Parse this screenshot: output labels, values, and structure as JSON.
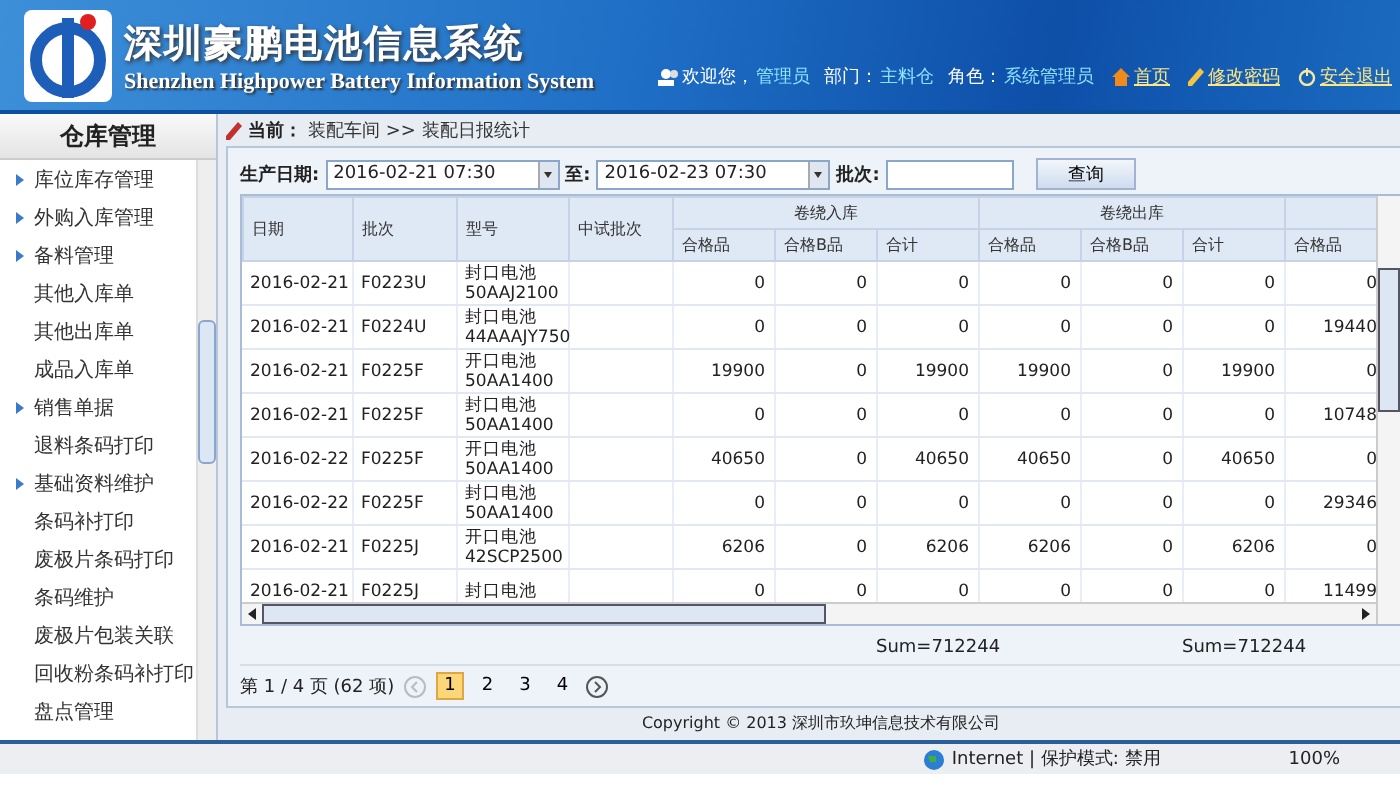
{
  "header": {
    "title": "深圳豪鹏电池信息系统",
    "subtitle": "Shenzhen Highpower Battery Information System",
    "welcome_label": "欢迎您，",
    "user": "管理员",
    "dept_label": "部门：",
    "dept": "主料仓",
    "role_label": "角色：",
    "role": "系统管理员",
    "links": [
      {
        "label": "首页",
        "kind": "home"
      },
      {
        "label": "修改密码",
        "kind": "password"
      },
      {
        "label": "安全退出",
        "kind": "logout"
      }
    ]
  },
  "sidebar": {
    "title": "仓库管理",
    "items": [
      {
        "label": "库位库存管理",
        "expandable": true
      },
      {
        "label": "外购入库管理",
        "expandable": true
      },
      {
        "label": "备料管理",
        "expandable": true
      },
      {
        "label": "其他入库单",
        "expandable": false
      },
      {
        "label": "其他出库单",
        "expandable": false
      },
      {
        "label": "成品入库单",
        "expandable": false
      },
      {
        "label": "销售单据",
        "expandable": true
      },
      {
        "label": "退料条码打印",
        "expandable": false
      },
      {
        "label": "基础资料维护",
        "expandable": true
      },
      {
        "label": "条码补打印",
        "expandable": false
      },
      {
        "label": "废极片条码打印",
        "expandable": false
      },
      {
        "label": "条码维护",
        "expandable": false
      },
      {
        "label": "废极片包装关联",
        "expandable": false
      },
      {
        "label": "回收粉条码补打印",
        "expandable": false
      },
      {
        "label": "盘点管理",
        "expandable": false
      }
    ]
  },
  "breadcrumb": {
    "label": "当前：",
    "path": "装配车间 >> 装配日报统计"
  },
  "filters": {
    "date_label": "生产日期:",
    "from": "2016-02-21 07:30",
    "to_label": "至:",
    "to": "2016-02-23 07:30",
    "batch_label": "批次:",
    "search_button": "查询"
  },
  "table": {
    "columns": [
      "日期",
      "批次",
      "型号",
      "中试批次"
    ],
    "groups": [
      {
        "label": "卷绕入库",
        "columns": [
          "合格品",
          "合格B品",
          "合计"
        ],
        "sum": "Sum=712244"
      },
      {
        "label": "卷绕出库",
        "columns": [
          "合格品",
          "合格B品",
          "合计"
        ],
        "sum": "Sum=712244"
      },
      {
        "columns": [
          "合格品"
        ]
      }
    ],
    "rows": [
      {
        "date": "2016-02-21",
        "batch": "F0223U",
        "model": [
          "封口电池",
          "50AAJ2100"
        ],
        "values": [
          "0",
          "0",
          "0",
          "0",
          "0",
          "0",
          "0"
        ]
      },
      {
        "date": "2016-02-21",
        "batch": "F0224U",
        "model": [
          "封口电池",
          "44AAAJY750"
        ],
        "values": [
          "0",
          "0",
          "0",
          "0",
          "0",
          "0",
          "19440"
        ]
      },
      {
        "date": "2016-02-21",
        "batch": "F0225F",
        "model": [
          "开口电池",
          "50AA1400"
        ],
        "values": [
          "19900",
          "0",
          "19900",
          "19900",
          "0",
          "19900",
          "0"
        ]
      },
      {
        "date": "2016-02-21",
        "batch": "F0225F",
        "model": [
          "封口电池",
          "50AA1400"
        ],
        "values": [
          "0",
          "0",
          "0",
          "0",
          "0",
          "0",
          "10748"
        ]
      },
      {
        "date": "2016-02-22",
        "batch": "F0225F",
        "model": [
          "开口电池",
          "50AA1400"
        ],
        "values": [
          "40650",
          "0",
          "40650",
          "40650",
          "0",
          "40650",
          "0"
        ]
      },
      {
        "date": "2016-02-22",
        "batch": "F0225F",
        "model": [
          "封口电池",
          "50AA1400"
        ],
        "values": [
          "0",
          "0",
          "0",
          "0",
          "0",
          "0",
          "29346"
        ]
      },
      {
        "date": "2016-02-21",
        "batch": "F0225J",
        "model": [
          "开口电池",
          "42SCP2500"
        ],
        "values": [
          "6206",
          "0",
          "6206",
          "6206",
          "0",
          "6206",
          "0"
        ]
      },
      {
        "date": "2016-02-21",
        "batch": "F0225J",
        "model": [
          "封口电池"
        ],
        "values": [
          "0",
          "0",
          "0",
          "0",
          "0",
          "0",
          "11499"
        ]
      }
    ]
  },
  "pager": {
    "summary": "第 1 / 4 页 (62 项)",
    "pages": [
      {
        "label": "1",
        "selected": true
      },
      {
        "label": "2",
        "selected": false
      },
      {
        "label": "3",
        "selected": false
      },
      {
        "label": "4",
        "selected": false
      }
    ]
  },
  "footer": "Copyright © 2013 深圳市玖坤信息技术有限公司",
  "status_bar": {
    "zone": "Internet | 保护模式: 禁用",
    "zoom": "100%"
  }
}
